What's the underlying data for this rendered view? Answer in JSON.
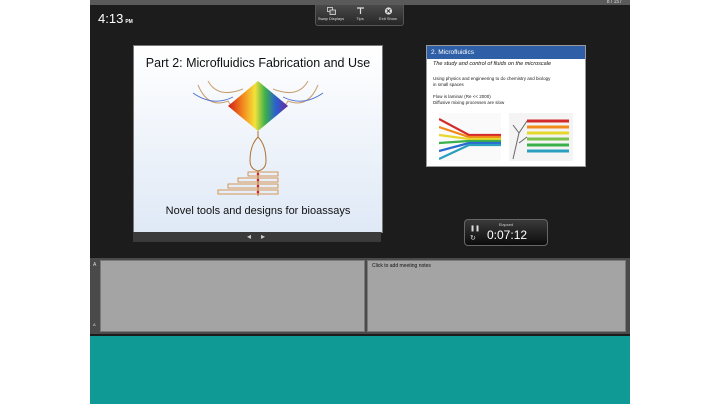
{
  "header": {
    "slide_counter": "8 / 157"
  },
  "clock": {
    "time": "4:13",
    "ampm": "PM"
  },
  "toolbar": {
    "swap_label": "Swap Displays",
    "tips_label": "Tips",
    "exit_label": "Exit Show"
  },
  "current_slide": {
    "title": "Part 2: Microfluidics Fabrication and Use",
    "subtitle": "Novel tools and designs for bioassays"
  },
  "next_slide": {
    "heading": "2. Microfluidics",
    "subtitle": "The study and control of fluids on the microscale",
    "bullet1": "Using physics and engineering to do chemistry and biology",
    "bullet1b": "in small spaces",
    "bullet2": "Flow is laminar (Re << 2000)",
    "bullet3": "Diffusive mixing processes are slow"
  },
  "nav": {
    "prev": "◂",
    "next": "▸"
  },
  "timer": {
    "label": "Elapsed",
    "value": "0:07:12"
  },
  "notes": {
    "placeholder": "Click to add meeting notes",
    "size_small": "A",
    "size_large": "A"
  },
  "colors": {
    "accent_blue": "#2f5fa6",
    "background": "#1c1c1c",
    "teal": "#0f9a96"
  }
}
